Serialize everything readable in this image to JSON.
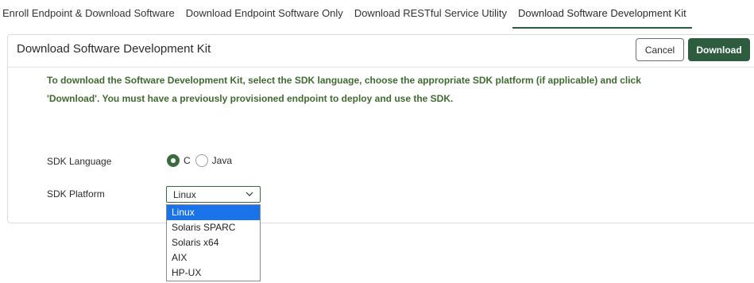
{
  "tabs": [
    {
      "label": "Enroll Endpoint & Download Software"
    },
    {
      "label": "Download Endpoint Software Only"
    },
    {
      "label": "Download RESTful Service Utility"
    },
    {
      "label": "Download Software Development Kit"
    }
  ],
  "active_tab": "Download Software Development Kit",
  "panel": {
    "title": "Download Software Development Kit",
    "cancel_label": "Cancel",
    "download_label": "Download",
    "instructions_line1": "To download the Software Development Kit, select the SDK language, choose the appropriate SDK platform (if applicable) and click",
    "instructions_line2": "'Download'. You must have a previously provisioned endpoint to deploy and use the SDK."
  },
  "form": {
    "language_label": "SDK Language",
    "language_options": [
      {
        "label": "C",
        "checked": true
      },
      {
        "label": "Java",
        "checked": false
      }
    ],
    "platform_label": "SDK Platform",
    "platform_selected": "Linux",
    "platform_options": [
      "Linux",
      "Solaris SPARC",
      "Solaris x64",
      "AIX",
      "HP-UX"
    ]
  },
  "colors": {
    "accent_green": "#2e5c3f",
    "instruction_text": "#3f6b30",
    "dropdown_highlight": "#1a73e8"
  },
  "icons": {
    "select_caret": "chevron-down-icon"
  }
}
